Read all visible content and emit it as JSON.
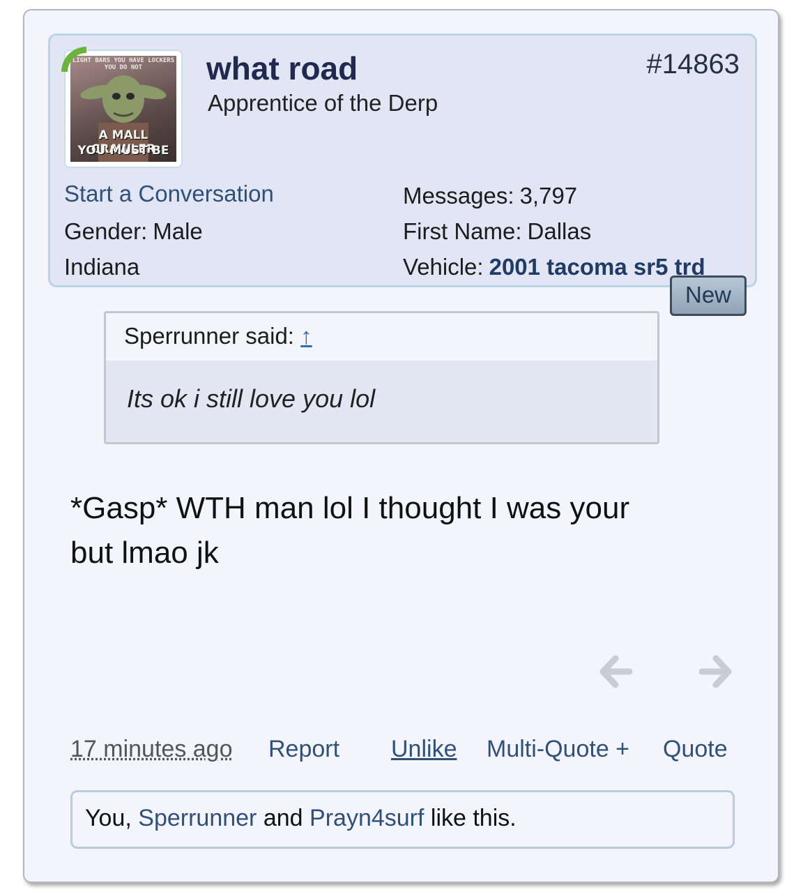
{
  "user": {
    "name": "what road",
    "title": "Apprentice of the Derp",
    "avatar_caption": [
      "LIGHT BARS YOU HAVE LOCKERS YOU DO NOT",
      "A MALL CRAWLER",
      "YOU MUST BE"
    ],
    "start_conversation": "Start a Conversation",
    "gender_label": "Gender:",
    "gender": "Male",
    "location": "Indiana",
    "messages_label": "Messages:",
    "messages": "3,797",
    "first_name_label": "First Name:",
    "first_name": "Dallas",
    "vehicle_label": "Vehicle:",
    "vehicle": "2001 tacoma sr5 trd"
  },
  "post": {
    "number": "#14863",
    "new_badge": "New",
    "quote_author": "Sperrunner said:",
    "quote_link": "↑",
    "quote_text": "Its ok i still love you lol",
    "message": "*Gasp* WTH man lol I thought I was your but lmao jk",
    "prev_icon": "arrow-left-icon",
    "next_icon": "arrow-right-icon"
  },
  "footer": {
    "timestamp": "17 minutes ago",
    "report": "Report",
    "unlike": "Unlike",
    "multiquote": "Multi-Quote +",
    "quote": "Quote"
  },
  "likes": {
    "you": "You,",
    "user1": "Sperrunner",
    "and": "and",
    "user2": "Prayn4surf",
    "suffix": "like this."
  },
  "colors": {
    "username": "#202a4e",
    "link": "#2f5179",
    "panel": "#e2e5f4",
    "background": "#f4f5fc"
  }
}
